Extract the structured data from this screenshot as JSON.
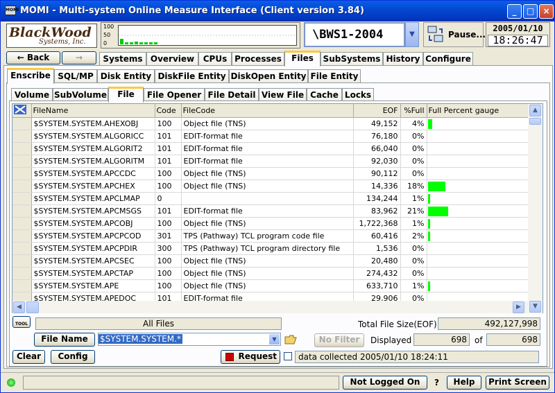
{
  "window": {
    "title": "MOMI - Multi-system Online Measure Interface (Client version 3.84)",
    "app_icon": "MOMI",
    "minimize": "_",
    "maximize": "□",
    "close": "×"
  },
  "logo": {
    "line1": "BlackWood",
    "line2": "Systems, Inc."
  },
  "activity_chart": {
    "y_labels": [
      "100",
      "50",
      "0"
    ],
    "color": "#00cc00"
  },
  "system": {
    "name": "\\BWS1-2004",
    "dropdown_icon": "chevron-down-icon"
  },
  "pause": {
    "label": "Pause..."
  },
  "datetime": {
    "date": "2005/01/10",
    "time": "18:26:47"
  },
  "nav": {
    "back_label": "Back",
    "back_arrow": "←",
    "fwd_arrow": "→"
  },
  "main_tabs": [
    "Systems",
    "Overview",
    "CPUs",
    "Processes",
    "Files",
    "SubSystems",
    "History",
    "Configure"
  ],
  "main_tab_selected": "Files",
  "sub_tabs": [
    "Enscribe",
    "SQL/MP",
    "Disk Entity",
    "DiskFile Entity",
    "DiskOpen Entity",
    "File Entity"
  ],
  "sub_tab_selected": "Enscribe",
  "sub_sub_tabs": [
    "Volume",
    "SubVolume",
    "File",
    "File Opener",
    "File Detail",
    "View File",
    "Cache",
    "Locks"
  ],
  "sub_sub_tab_selected": "File",
  "grid": {
    "columns": [
      "FileName",
      "Code",
      "FileCode",
      "EOF",
      "%Full",
      "Full Percent gauge"
    ],
    "gauge_color": "#00ff00",
    "rows": [
      {
        "name": "$SYSTEM.SYSTEM.AHEXOBJ",
        "code": "100",
        "filecode": "Object file (TNS)",
        "eof": "49,152",
        "pct": "4%",
        "gauge": 4
      },
      {
        "name": "$SYSTEM.SYSTEM.ALGORICC",
        "code": "101",
        "filecode": "EDIT-format file",
        "eof": "76,180",
        "pct": "0%",
        "gauge": 0
      },
      {
        "name": "$SYSTEM.SYSTEM.ALGORIT2",
        "code": "101",
        "filecode": "EDIT-format file",
        "eof": "66,040",
        "pct": "0%",
        "gauge": 0
      },
      {
        "name": "$SYSTEM.SYSTEM.ALGORITM",
        "code": "101",
        "filecode": "EDIT-format file",
        "eof": "92,030",
        "pct": "0%",
        "gauge": 0
      },
      {
        "name": "$SYSTEM.SYSTEM.APCCDC",
        "code": "100",
        "filecode": "Object file (TNS)",
        "eof": "90,112",
        "pct": "0%",
        "gauge": 0
      },
      {
        "name": "$SYSTEM.SYSTEM.APCHEX",
        "code": "100",
        "filecode": "Object file (TNS)",
        "eof": "14,336",
        "pct": "18%",
        "gauge": 18
      },
      {
        "name": "$SYSTEM.SYSTEM.APCLMAP",
        "code": "0",
        "filecode": "",
        "eof": "134,244",
        "pct": "1%",
        "gauge": 1
      },
      {
        "name": "$SYSTEM.SYSTEM.APCMSGS",
        "code": "101",
        "filecode": "EDIT-format file",
        "eof": "83,962",
        "pct": "21%",
        "gauge": 21
      },
      {
        "name": "$SYSTEM.SYSTEM.APCOBJ",
        "code": "100",
        "filecode": "Object file (TNS)",
        "eof": "1,722,368",
        "pct": "1%",
        "gauge": 1
      },
      {
        "name": "$SYSTEM.SYSTEM.APCPCOD",
        "code": "301",
        "filecode": "TPS (Pathway) TCL program code file",
        "eof": "60,416",
        "pct": "2%",
        "gauge": 2
      },
      {
        "name": "$SYSTEM.SYSTEM.APCPDIR",
        "code": "300",
        "filecode": "TPS (Pathway) TCL program directory file",
        "eof": "1,536",
        "pct": "0%",
        "gauge": 0
      },
      {
        "name": "$SYSTEM.SYSTEM.APCSEC",
        "code": "100",
        "filecode": "Object file (TNS)",
        "eof": "20,480",
        "pct": "0%",
        "gauge": 0
      },
      {
        "name": "$SYSTEM.SYSTEM.APCTAP",
        "code": "100",
        "filecode": "Object file (TNS)",
        "eof": "274,432",
        "pct": "0%",
        "gauge": 0
      },
      {
        "name": "$SYSTEM.SYSTEM.APE",
        "code": "100",
        "filecode": "Object file (TNS)",
        "eof": "633,710",
        "pct": "1%",
        "gauge": 1
      },
      {
        "name": "$SYSTEM.SYSTEM.APEDOC",
        "code": "101",
        "filecode": "EDIT-format file",
        "eof": "29,906",
        "pct": "0%",
        "gauge": 0
      }
    ]
  },
  "bottom": {
    "tool_label": "TOOL",
    "all_files": "All Files",
    "total_label": "Total File Size(EOF)",
    "total_value": "492,127,998",
    "file_name_btn": "File Name",
    "filter_value": "$SYSTEM.SYSTEM.*",
    "no_filter_btn": "No Filter",
    "displayed_label": "Displayed",
    "displayed_value": "698",
    "of_label": "of",
    "of_value": "698",
    "clear_btn": "Clear",
    "config_btn": "Config",
    "request_btn": "Request",
    "collected_text": "data collected 2005/01/10 18:24:11"
  },
  "statusbar": {
    "not_logged_on": "Not Logged On",
    "question": "?",
    "help_btn": "Help",
    "print_btn": "Print Screen"
  }
}
